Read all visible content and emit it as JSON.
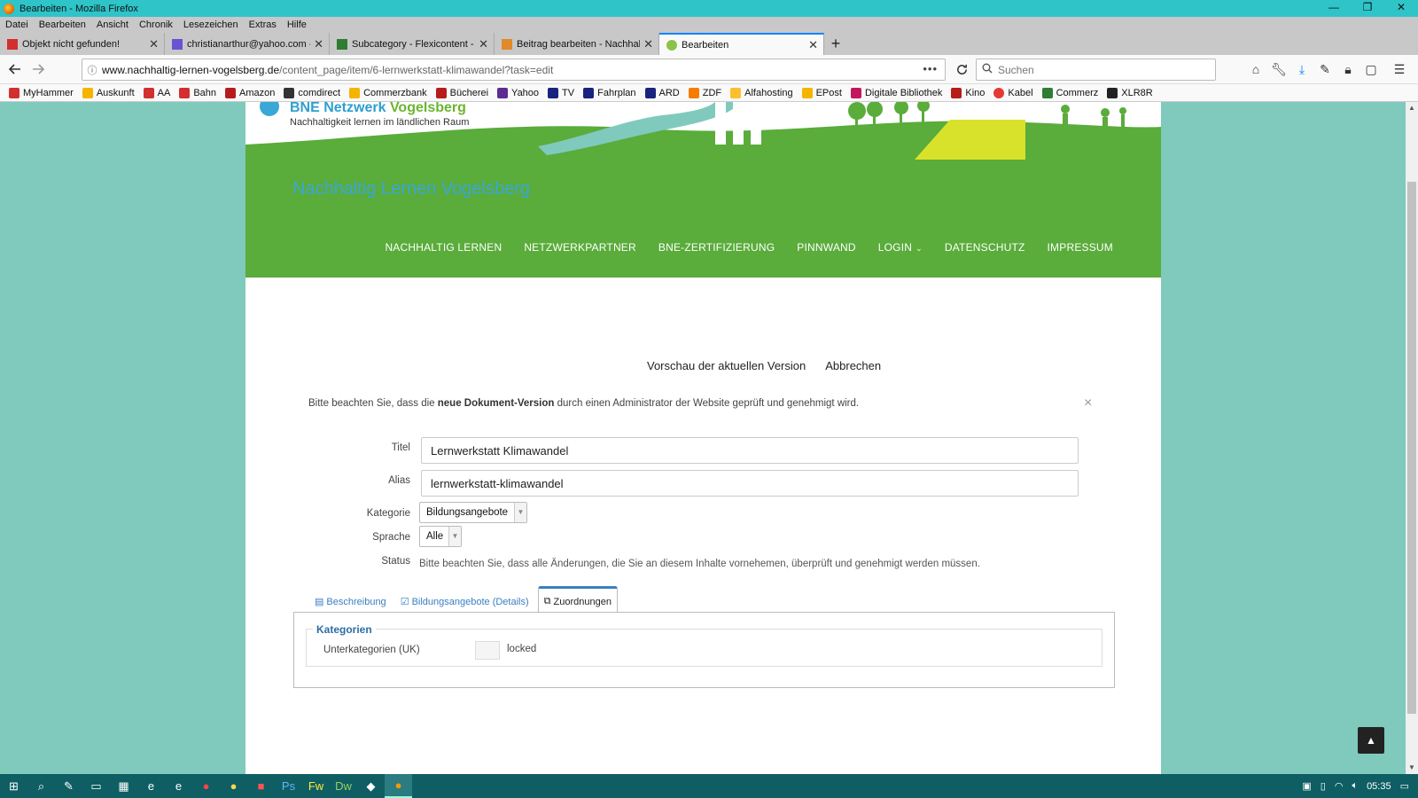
{
  "window": {
    "title": "Bearbeiten - Mozilla Firefox",
    "controls": [
      "—",
      "❐",
      "✕"
    ]
  },
  "menubar": [
    "Datei",
    "Bearbeiten",
    "Ansicht",
    "Chronik",
    "Lesezeichen",
    "Extras",
    "Hilfe"
  ],
  "tabs": [
    {
      "title": "Objekt nicht gefunden!",
      "icon_color": "#d32f2f",
      "active": false
    },
    {
      "title": "christianarthur@yahoo.com - Y",
      "icon_color": "#6a52d1",
      "active": false
    },
    {
      "title": "Subcategory - Flexicontent - Fl",
      "icon_color": "#2e7d32",
      "active": false
    },
    {
      "title": "Beitrag bearbeiten - Nachhaltig",
      "icon_color": "#e08a2b",
      "active": false
    },
    {
      "title": "Bearbeiten",
      "icon_color": "#8bc34a",
      "active": true
    }
  ],
  "newtab_label": "+",
  "urlbar": {
    "domain": "www.nachhaltig-lernen-vogelsberg.de",
    "path": "/content_page/item/6-lernwerkstatt-klimawandel?task=edit",
    "dots": "•••"
  },
  "searchbar": {
    "placeholder": "Suchen"
  },
  "bookmarks": [
    {
      "label": "MyHammer",
      "color": "#d32f2f"
    },
    {
      "label": "Auskunft",
      "color": "#f5b400"
    },
    {
      "label": "AA",
      "color": "#d32f2f"
    },
    {
      "label": "Bahn",
      "color": "#d32f2f"
    },
    {
      "label": "Amazon",
      "color": "#b71c1c"
    },
    {
      "label": "comdirect",
      "color": "#333333"
    },
    {
      "label": "Commerzbank",
      "color": "#f5b400"
    },
    {
      "label": "Bücherei",
      "color": "#b71c1c"
    },
    {
      "label": "Yahoo",
      "color": "#5b2d90"
    },
    {
      "label": "TV",
      "color": "#1a237e"
    },
    {
      "label": "Fahrplan",
      "color": "#1a237e"
    },
    {
      "label": "ARD",
      "color": "#1a237e"
    },
    {
      "label": "ZDF",
      "color": "#f57c00"
    },
    {
      "label": "Alfahosting",
      "color": "#fbc02d"
    },
    {
      "label": "EPost",
      "color": "#f5b400"
    },
    {
      "label": "Digitale Bibliothek",
      "color": "#c2185b"
    },
    {
      "label": "Kino",
      "color": "#b71c1c"
    },
    {
      "label": "Kabel",
      "color": "#e53935"
    },
    {
      "label": "Commerz",
      "color": "#2e7d32"
    },
    {
      "label": "XLR8R",
      "color": "#222222"
    }
  ],
  "site": {
    "brand_title_a": "BNE Netzwerk",
    "brand_title_b": "Vogelsberg",
    "brand_sub": "Nachhaltigkeit lernen im ländlichen Raum",
    "site_title": "Nachhaltig Lernen Vogelsberg",
    "nav": [
      "NACHHALTIG LERNEN",
      "NETZWERKPARTNER",
      "BNE-ZERTIFIZIERUNG",
      "PINNWAND",
      "LOGIN",
      "DATENSCHUTZ",
      "IMPRESSUM"
    ],
    "login_chevron": "⌄"
  },
  "edit": {
    "preview_label": "Vorschau der aktuellen Version",
    "cancel_label": "Abbrechen",
    "notice_pre": "Bitte beachten Sie, dass die ",
    "notice_bold": "neue Dokument-Version",
    "notice_post": " durch einen Administrator der Website geprüft und genehmigt wird.",
    "notice_close": "×",
    "title_label": "Titel",
    "title_value": "Lernwerkstatt Klimawandel",
    "alias_label": "Alias",
    "alias_value": "lernwerkstatt-klimawandel",
    "category_label": "Kategorie",
    "category_value": "Bildungsangebote",
    "language_label": "Sprache",
    "language_value": "Alle",
    "status_label": "Status",
    "status_text": "Bitte beachten Sie, dass alle Änderungen, die Sie an diesem Inhalte vornehemen, überprüft und genehmigt werden müssen.",
    "tabs": [
      "Beschreibung",
      "Bildungsangebote (Details)",
      "Zuordnungen"
    ],
    "active_tab": "Zuordnungen",
    "legend": "Kategorien",
    "uk_label": "Unterkategorien (UK)",
    "uk_value": "locked"
  },
  "totop_label": "▲",
  "taskbar": {
    "time": "05:35"
  },
  "colors": {
    "green": "#5aac3b",
    "blue_title": "#3aa7d6",
    "page_bg": "#7fcabd",
    "firefox_title": "#2ec4c8"
  }
}
